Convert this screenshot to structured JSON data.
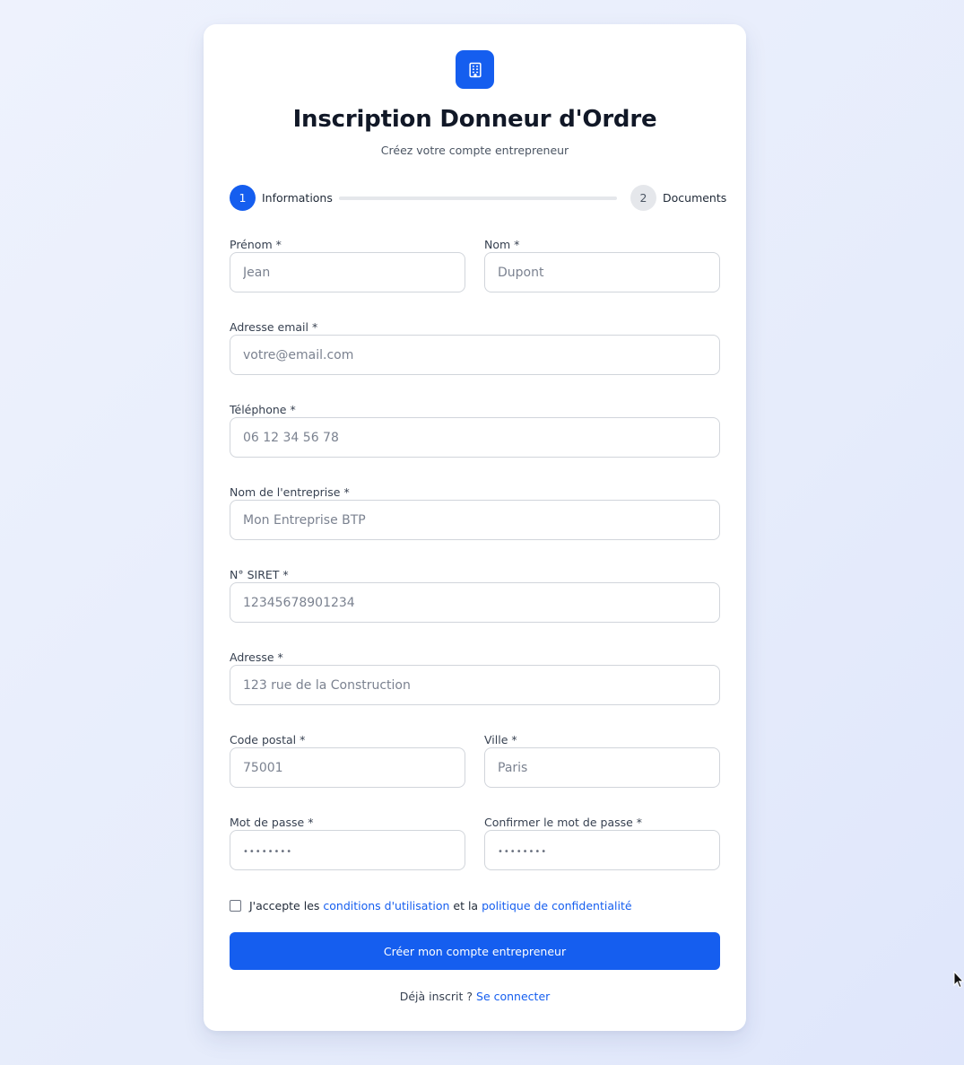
{
  "header": {
    "logo_icon": "building-icon",
    "title": "Inscription Donneur d'Ordre",
    "subtitle": "Créez votre compte entrepreneur"
  },
  "steps": [
    {
      "number": "1",
      "label": "Informations",
      "active": true
    },
    {
      "number": "2",
      "label": "Documents",
      "active": false
    }
  ],
  "form": {
    "prenom": {
      "label": "Prénom *",
      "placeholder": "Jean",
      "value": ""
    },
    "nom": {
      "label": "Nom *",
      "placeholder": "Dupont",
      "value": ""
    },
    "email": {
      "label": "Adresse email *",
      "placeholder": "votre@email.com",
      "value": ""
    },
    "telephone": {
      "label": "Téléphone *",
      "placeholder": "06 12 34 56 78",
      "value": ""
    },
    "entreprise": {
      "label": "Nom de l'entreprise *",
      "placeholder": "Mon Entreprise BTP",
      "value": ""
    },
    "siret": {
      "label": "N° SIRET *",
      "placeholder": "12345678901234",
      "value": ""
    },
    "adresse": {
      "label": "Adresse *",
      "placeholder": "123 rue de la Construction",
      "value": ""
    },
    "code_postal": {
      "label": "Code postal *",
      "placeholder": "75001",
      "value": ""
    },
    "ville": {
      "label": "Ville *",
      "placeholder": "Paris",
      "value": ""
    },
    "password": {
      "label": "Mot de passe *",
      "placeholder": "••••••••",
      "value": ""
    },
    "password_confirm": {
      "label": "Confirmer le mot de passe *",
      "placeholder": "••••••••",
      "value": ""
    }
  },
  "agreement": {
    "checked": false,
    "prefix": "J'accepte les",
    "terms_link": "conditions d'utilisation",
    "middle": "et la",
    "privacy_link": "politique de confidentialité"
  },
  "submit_label": "Créer mon compte entrepreneur",
  "login": {
    "prompt": "Déjà inscrit ?",
    "link": "Se connecter"
  },
  "colors": {
    "accent": "#155eef",
    "background": "#eaf0fc",
    "card": "#ffffff"
  }
}
